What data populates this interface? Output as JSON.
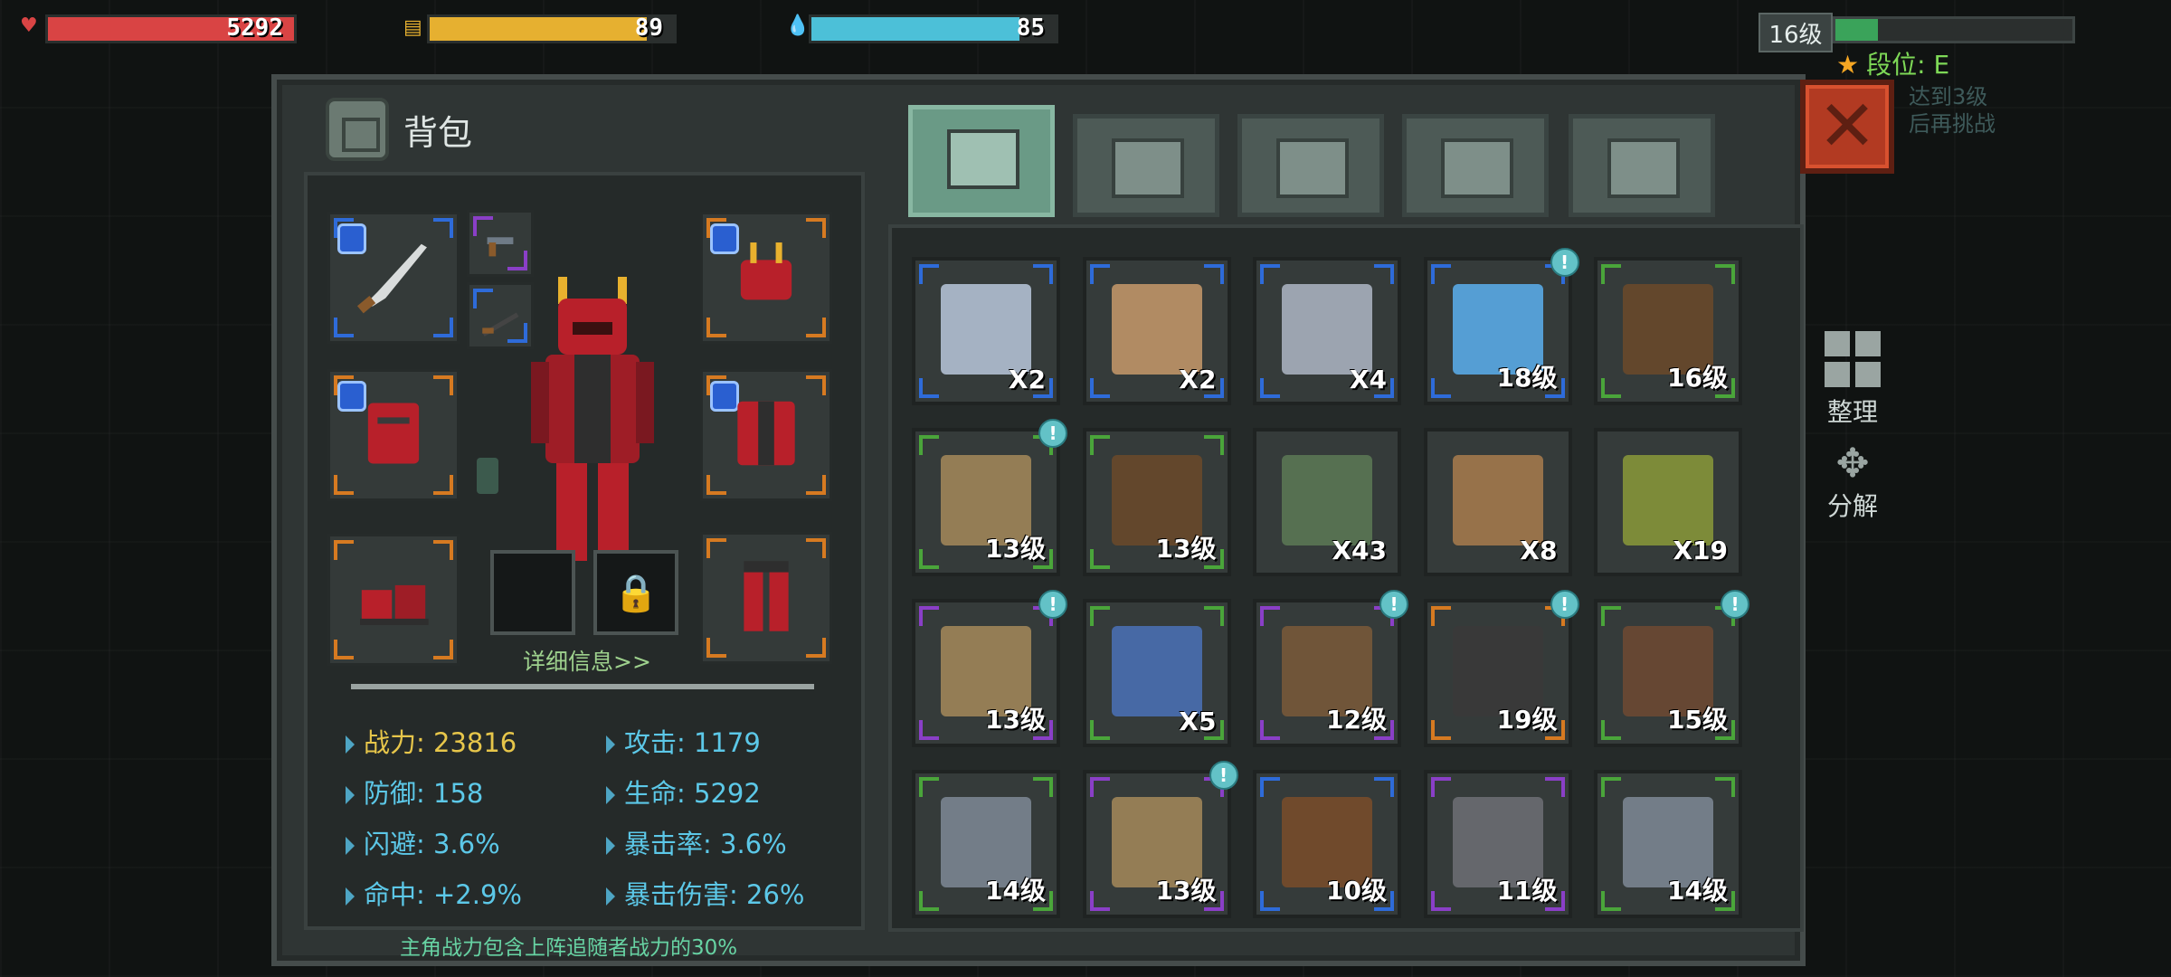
{
  "hud": {
    "health": {
      "value": "5292",
      "icon": "heart-icon",
      "fill": 1.0,
      "color": "#d94444"
    },
    "hunger": {
      "value": "89",
      "icon": "food-icon",
      "fill": 0.89,
      "color": "#e6b030"
    },
    "water": {
      "value": "85",
      "icon": "water-drop-icon",
      "fill": 0.85,
      "color": "#4cc0d8"
    },
    "level": "16级",
    "level_progress": 0.18,
    "rank": "段位: E",
    "faded_text": [
      "达到3级",
      "后再挑战"
    ]
  },
  "panel": {
    "title": "背包",
    "close_icon": "close-icon",
    "tabs": [
      {
        "name": "backpack",
        "icon": "backpack-icon",
        "active": true
      },
      {
        "name": "medical",
        "icon": "medkit-icon",
        "active": false
      },
      {
        "name": "materials",
        "icon": "wing-icon",
        "active": false
      },
      {
        "name": "weapons",
        "icon": "gun-icon",
        "active": false
      },
      {
        "name": "tools",
        "icon": "wrench-icon",
        "active": false
      }
    ]
  },
  "character": {
    "detail_link": "详细信息>>",
    "stats": [
      {
        "label": "战力: 23816"
      },
      {
        "label": "攻击: 1179"
      },
      {
        "label": "防御: 158"
      },
      {
        "label": "生命: 5292"
      },
      {
        "label": "闪避: 3.6%"
      },
      {
        "label": "暴击率: 3.6%"
      },
      {
        "label": "命中: +2.9%"
      },
      {
        "label": "暴击伤害: 26%"
      }
    ],
    "note": "主角战力包含上阵追随者战力的30%"
  },
  "inventory": [
    {
      "item": "map",
      "qty": "X2",
      "rarity": "blue",
      "badge": false
    },
    {
      "item": "seed-bag",
      "qty": "X2",
      "rarity": "blue",
      "badge": false
    },
    {
      "item": "adhesive",
      "qty": "X4",
      "rarity": "blue",
      "badge": false
    },
    {
      "item": "electric-blade",
      "qty": "18级",
      "rarity": "blue",
      "badge": true
    },
    {
      "item": "rifle",
      "qty": "16级",
      "rarity": "green",
      "badge": false
    },
    {
      "item": "pants",
      "qty": "13级",
      "rarity": "green",
      "badge": true
    },
    {
      "item": "shotgun",
      "qty": "13级",
      "rarity": "green",
      "badge": false
    },
    {
      "item": "soup-pot",
      "qty": "X43",
      "rarity": "none",
      "badge": false
    },
    {
      "item": "grain-sack",
      "qty": "X8",
      "rarity": "none",
      "badge": false
    },
    {
      "item": "herbs",
      "qty": "X19",
      "rarity": "none",
      "badge": false
    },
    {
      "item": "pants",
      "qty": "13级",
      "rarity": "purple",
      "badge": true
    },
    {
      "item": "computer",
      "qty": "X5",
      "rarity": "green",
      "badge": false
    },
    {
      "item": "boots",
      "qty": "12级",
      "rarity": "purple",
      "badge": true
    },
    {
      "item": "crossbow",
      "qty": "19级",
      "rarity": "orange",
      "badge": true
    },
    {
      "item": "leather-jacket",
      "qty": "15级",
      "rarity": "green",
      "badge": true
    },
    {
      "item": "revolver",
      "qty": "14级",
      "rarity": "green",
      "badge": false
    },
    {
      "item": "pants",
      "qty": "13级",
      "rarity": "purple",
      "badge": true
    },
    {
      "item": "ak-rifle",
      "qty": "10级",
      "rarity": "blue",
      "badge": false
    },
    {
      "item": "pistol",
      "qty": "11级",
      "rarity": "purple",
      "badge": false
    },
    {
      "item": "revolver",
      "qty": "14级",
      "rarity": "green",
      "badge": false
    }
  ],
  "side_actions": {
    "sort": "整理",
    "decompose": "分解"
  },
  "badge_symbol": "!"
}
